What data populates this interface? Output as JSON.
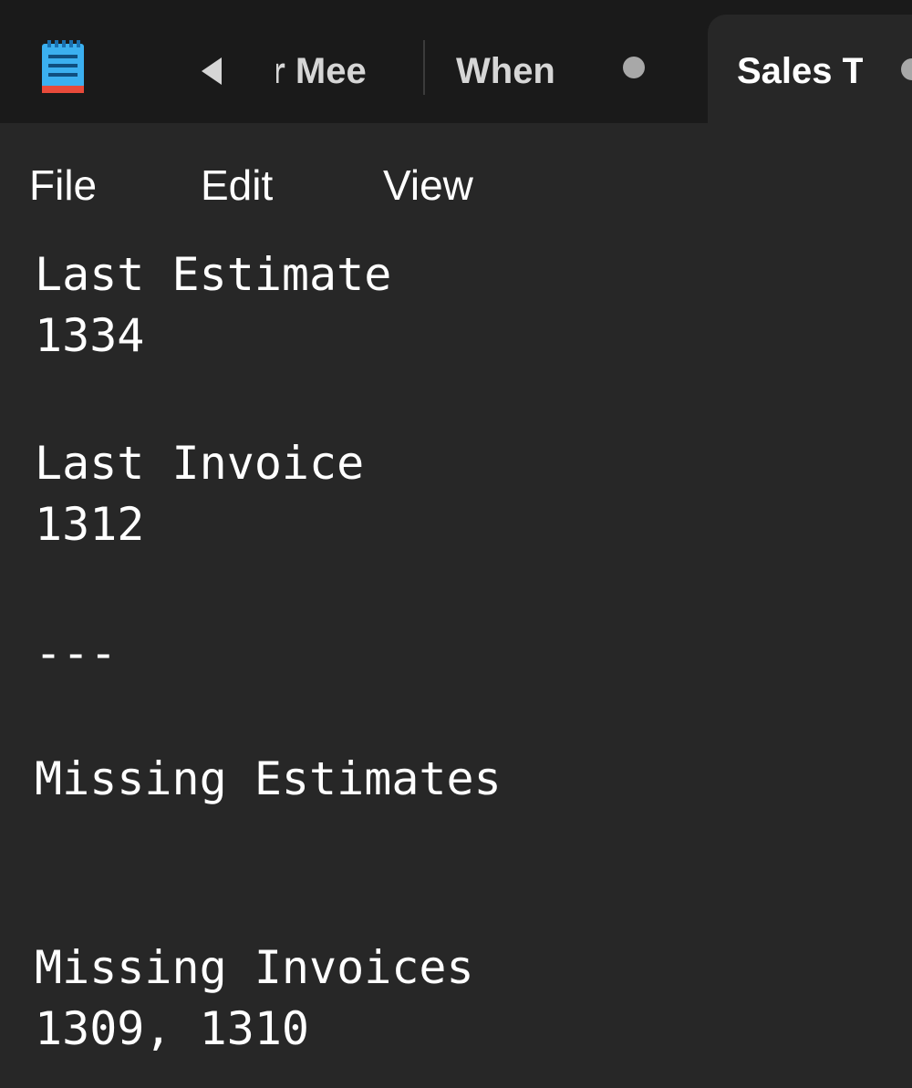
{
  "app": {
    "icon": "notepad-icon"
  },
  "tabs": [
    {
      "label": "Winter Meet",
      "visible_fragment": "er Mee",
      "modified": false
    },
    {
      "label": "When",
      "modified": true
    },
    {
      "label": "Sales T",
      "active": true,
      "modified": true
    }
  ],
  "menu": {
    "file": "File",
    "edit": "Edit",
    "view": "View"
  },
  "document": {
    "lines": [
      "Last Estimate",
      "1334",
      "",
      "Last Invoice",
      "1312",
      "",
      "---",
      "",
      "Missing Estimates",
      "",
      "",
      "Missing Invoices",
      "1309, 1310"
    ]
  },
  "colors": {
    "titlebar_bg": "#1a1a1a",
    "editor_bg": "#272727",
    "text": "#ffffff",
    "tab_text_inactive": "#d6d6d6",
    "modified_dot": "#a8a8a8"
  }
}
